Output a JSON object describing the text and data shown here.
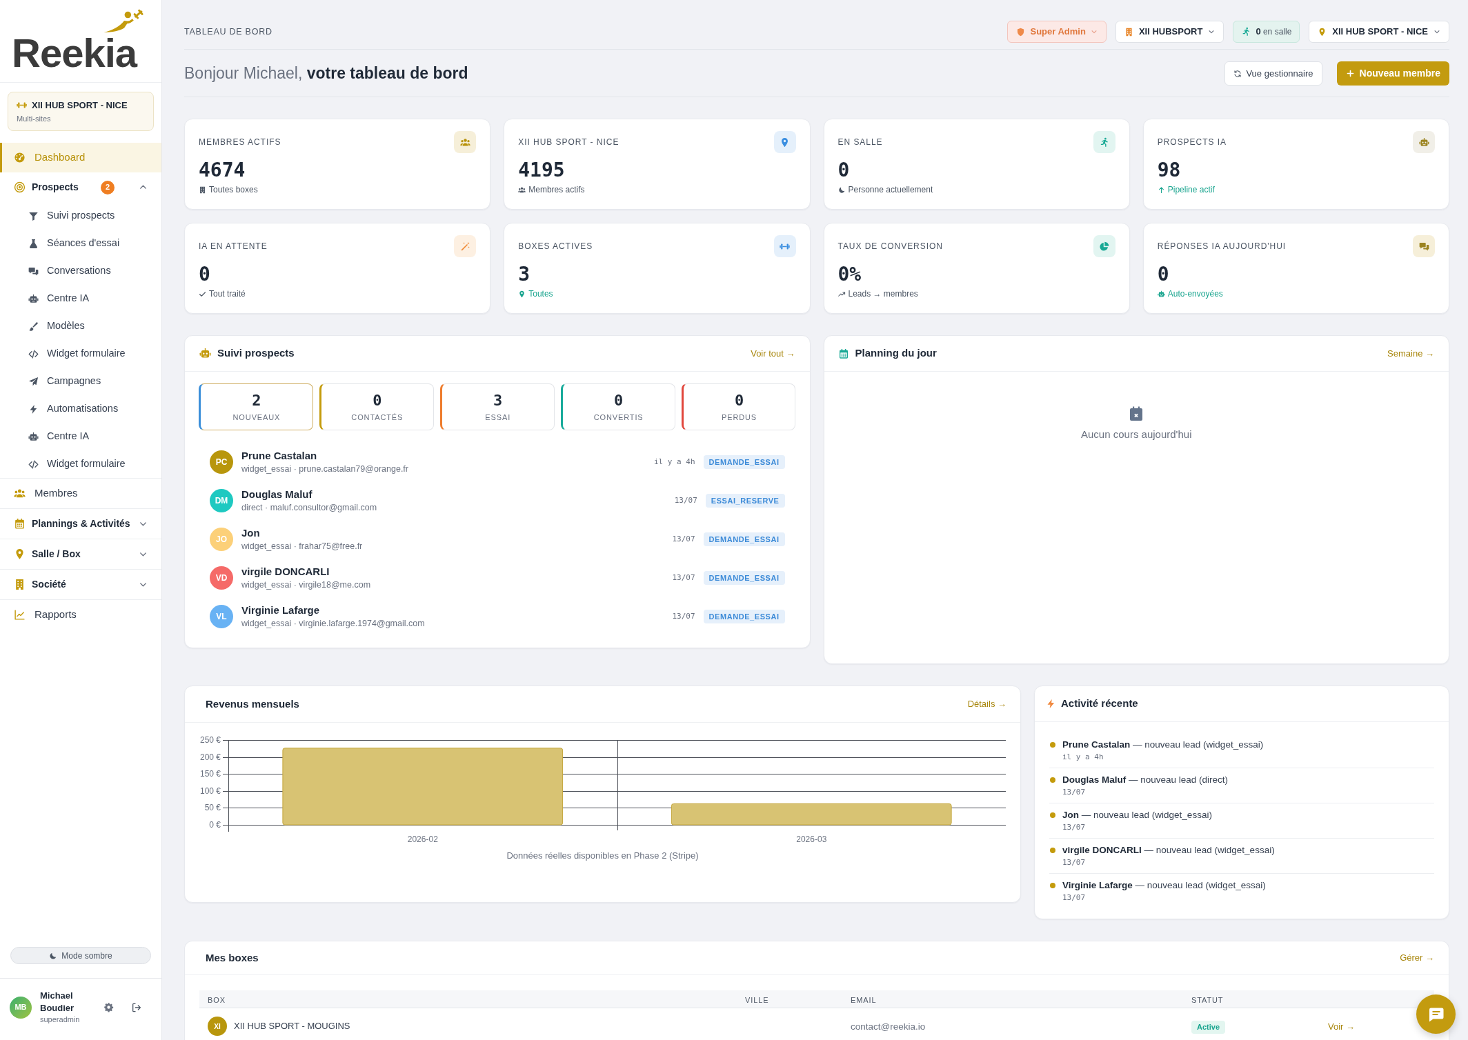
{
  "sidebar": {
    "logo": "Reekia",
    "site": {
      "name": "XII HUB SPORT - NICE",
      "subtitle": "Multi-sites"
    },
    "nav": [
      {
        "kind": "link",
        "label": "Dashboard",
        "selected": true
      },
      {
        "kind": "group",
        "label": "Prospects",
        "badge": "2",
        "expanded": true,
        "selected": false,
        "children": [
          {
            "label": "Suivi prospects",
            "selected": false
          },
          {
            "label": "Séances d'essai",
            "selected": false
          },
          {
            "label": "Conversations",
            "selected": false
          },
          {
            "label": "Centre IA",
            "selected": false
          },
          {
            "label": "Modèles",
            "selected": false
          },
          {
            "label": "Widget formulaire",
            "selected": false
          },
          {
            "label": "Campagnes",
            "selected": false
          },
          {
            "label": "Automatisations",
            "selected": false
          },
          {
            "label": "Centre IA",
            "selected": false
          },
          {
            "label": "Widget formulaire",
            "selected": false
          }
        ]
      },
      {
        "kind": "link",
        "label": "Membres",
        "selected": false
      },
      {
        "kind": "group",
        "label": "Plannings & Activités",
        "expanded": false,
        "selected": false
      },
      {
        "kind": "group",
        "label": "Salle / Box",
        "expanded": false,
        "selected": false
      },
      {
        "kind": "group",
        "label": "Société",
        "expanded": false,
        "selected": false
      },
      {
        "kind": "link",
        "label": "Rapports",
        "selected": false
      }
    ],
    "theme_toggle": "Mode sombre",
    "user": {
      "initials": "MB",
      "name": "Michael Boudier",
      "role": "superadmin"
    }
  },
  "header": {
    "breadcrumb": "TABLEAU DE BORD",
    "role_menu": "Super Admin",
    "organization_menu": "XII HUBSPORT",
    "presence": "**0** en salle",
    "site_menu": "XII HUB SPORT - NICE"
  },
  "greeting": "Bonjour Michael, **votre tableau de bord**",
  "actions": [
    {
      "kind": "secondary",
      "label": "Vue gestionnaire"
    },
    {
      "kind": "primary",
      "label": "Nouveau membre"
    }
  ],
  "stats": [
    {
      "label": "MEMBRES ACTIFS",
      "value": "4674",
      "note": "Toutes boxes",
      "accent": false
    },
    {
      "label": "XII HUB SPORT - NICE",
      "value": "4195",
      "note": "Membres actifs",
      "accent": false
    },
    {
      "label": "EN SALLE",
      "value": "0",
      "note": "Personne actuellement",
      "accent": false
    },
    {
      "label": "PROSPECTS IA",
      "value": "98",
      "note": "Pipeline actif",
      "accent": true
    },
    {
      "label": "IA EN ATTENTE",
      "value": "0",
      "note": "Tout traité",
      "accent": false
    },
    {
      "label": "BOXES ACTIVES",
      "value": "3",
      "note": "Toutes",
      "accent": true
    },
    {
      "label": "TAUX DE CONVERSION",
      "value": "0%",
      "note": "Leads → membres",
      "accent": false
    },
    {
      "label": "RÉPONSES IA AUJOURD'HUI",
      "value": "0",
      "note": "Auto-envoyées",
      "accent": true
    }
  ],
  "prospects": {
    "title": "Suivi prospects",
    "link": "Voir tout →",
    "pipeline": [
      {
        "count": "2",
        "label": "NOUVEAUX",
        "color": "#3b8fd9",
        "selected": true
      },
      {
        "count": "0",
        "label": "CONTACTÉS",
        "color": "#c49b0c",
        "selected": false
      },
      {
        "count": "3",
        "label": "ESSAI",
        "color": "#ee7d2e",
        "selected": false
      },
      {
        "count": "0",
        "label": "CONVERTIS",
        "color": "#19ab9b",
        "selected": false
      },
      {
        "count": "0",
        "label": "PERDUS",
        "color": "#e1473d",
        "selected": false
      }
    ],
    "leads": [
      {
        "initials": "PC",
        "color": "#b8960c",
        "name": "Prune Castalan",
        "detail": "widget_essai · prune.castalan79@orange.fr",
        "time": "il y a 4h",
        "tag": "DEMANDE_ESSAI"
      },
      {
        "initials": "DM",
        "color": "#1ec9c1",
        "name": "Douglas Maluf",
        "detail": "direct · maluf.consultor@gmail.com",
        "time": "13/07",
        "tag": "ESSAI_RESERVE"
      },
      {
        "initials": "JO",
        "color": "#fcd079",
        "name": "Jon",
        "detail": "widget_essai · frahar75@free.fr",
        "time": "13/07",
        "tag": "DEMANDE_ESSAI"
      },
      {
        "initials": "VD",
        "color": "#f56a68",
        "name": "virgile DONCARLI",
        "detail": "widget_essai · virgile18@me.com",
        "time": "13/07",
        "tag": "DEMANDE_ESSAI"
      },
      {
        "initials": "VL",
        "color": "#68b2f4",
        "name": "Virginie Lafarge",
        "detail": "widget_essai · virginie.lafarge.1974@gmail.com",
        "time": "13/07",
        "tag": "DEMANDE_ESSAI"
      }
    ]
  },
  "planning": {
    "title": "Planning du jour",
    "link": "Semaine →",
    "empty": "Aucun cours aujourd'hui"
  },
  "revenue": {
    "title": "Revenus mensuels",
    "link": "Détails →",
    "chart_data": {
      "type": "bar",
      "categories": [
        "2026-02",
        "2026-03"
      ],
      "values": [
        226,
        62
      ],
      "color": "#d8c373",
      "ylim": [
        0,
        250
      ],
      "yticks": [
        {
          "value": 0,
          "label": "0 €"
        },
        {
          "value": 50,
          "label": "50 €"
        },
        {
          "value": 100,
          "label": "100 €"
        },
        {
          "value": 150,
          "label": "150 €"
        },
        {
          "value": 200,
          "label": "200 €"
        },
        {
          "value": 250,
          "label": "250 €"
        }
      ],
      "grid": true
    },
    "note": "Données réelles disponibles en Phase 2 (Stripe)"
  },
  "activity": {
    "title": "Activité récente",
    "items": [
      {
        "text": "**Prune Castalan** — nouveau lead (widget_essai)",
        "time": "il y a 4h"
      },
      {
        "text": "**Douglas Maluf** — nouveau lead (direct)",
        "time": "13/07"
      },
      {
        "text": "**Jon** — nouveau lead (widget_essai)",
        "time": "13/07"
      },
      {
        "text": "**virgile DONCARLI** — nouveau lead (widget_essai)",
        "time": "13/07"
      },
      {
        "text": "**Virginie Lafarge** — nouveau lead (widget_essai)",
        "time": "13/07"
      }
    ]
  },
  "boxes": {
    "title": "Mes boxes",
    "link": "Gérer →",
    "columns": [
      "BOX",
      "VILLE",
      "EMAIL",
      "STATUT"
    ],
    "rows": [
      {
        "initials": "XI",
        "name": "XII HUB SPORT - MOUGINS",
        "email": "contact@reekia.io",
        "status": "Active",
        "action": "Voir →"
      }
    ]
  }
}
